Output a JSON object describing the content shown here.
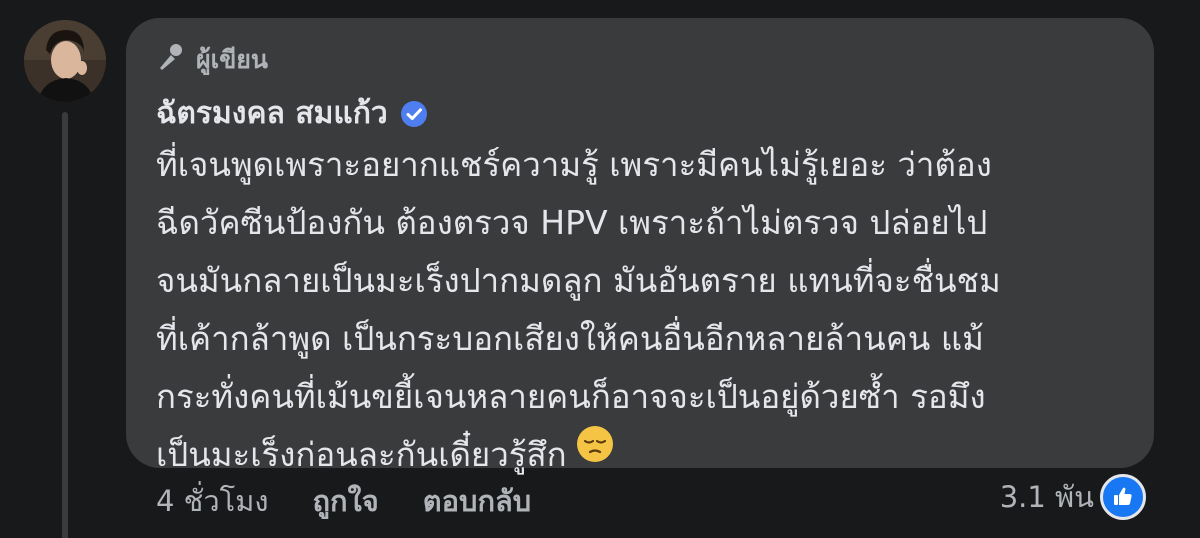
{
  "comment": {
    "author_badge_label": "ผู้เขียน",
    "author_name": "ฉัตรมงคล สมแก้ว",
    "text_lines": [
      "ที่เจนพูดเพราะอยากแชร์ความรู้ เพราะมีคนไม่รู้เยอะ ว่าต้อง",
      "ฉีดวัคซีนป้องกัน ต้องตรวจ HPV เพราะถ้าไม่ตรวจ ปล่อยไป",
      "จนมันกลายเป็นมะเร็งปากมดลูก มันอันตราย แทนที่จะชื่นชม",
      "ที่เค้ากล้าพูด เป็นกระบอกเสียงให้คนอื่นอีกหลายล้านคน แม้",
      "กระทั่งคนที่เม้นขยี้เจนหลายคนก็อาจจะเป็นอยู่ด้วยซ้ำ รอมึง",
      "เป็นมะเร็งก่อนละกันเดี๋ยวรู้สึก"
    ],
    "emoji_icon": "relieved-face-emoji"
  },
  "actions": {
    "time": "4 ชั่วโมง",
    "like_label": "ถูกใจ",
    "reply_label": "ตอบกลับ"
  },
  "reactions": {
    "count": "3.1 พัน",
    "icon": "thumbs-up-icon"
  },
  "colors": {
    "background": "#18191a",
    "bubble": "#3a3b3c",
    "primary_text": "#e4e6eb",
    "secondary_text": "#b0b3b8",
    "verified_blue": "#1877f2"
  }
}
